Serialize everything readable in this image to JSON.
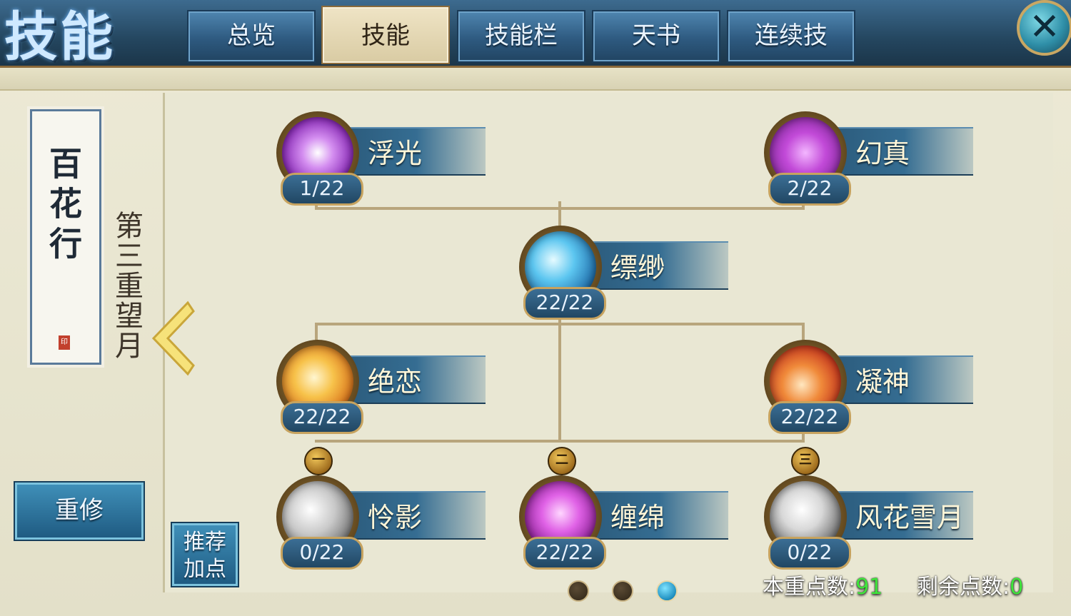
{
  "header": {
    "title": "技能",
    "tabs": [
      {
        "label": "总览",
        "active": false
      },
      {
        "label": "技能",
        "active": true
      },
      {
        "label": "技能栏",
        "active": false
      },
      {
        "label": "天书",
        "active": false
      },
      {
        "label": "连续技",
        "active": false
      }
    ],
    "close_icon": "close-icon"
  },
  "sidebar": {
    "school_name": "百花行",
    "chapter": "第三重望月",
    "rebuild_label": "重修",
    "recommend_label": "推荐\n加点"
  },
  "skills": [
    {
      "name": "浮光",
      "level": "1/22",
      "color": "#b24fd6"
    },
    {
      "name": "幻真",
      "level": "2/22",
      "color": "#c05ad8"
    },
    {
      "name": "缥缈",
      "level": "22/22",
      "color": "#3aa4e0"
    },
    {
      "name": "绝恋",
      "level": "22/22",
      "color": "#f0a62a"
    },
    {
      "name": "凝神",
      "level": "22/22",
      "color": "#e2562d"
    },
    {
      "name": "怜影",
      "level": "0/22",
      "color": "#9a9a9a"
    },
    {
      "name": "缠绵",
      "level": "22/22",
      "color": "#c748cf"
    },
    {
      "name": "风花雪月",
      "level": "0/22",
      "color": "#8a8a8a"
    }
  ],
  "tier_badges": [
    "一",
    "二",
    "三"
  ],
  "footer": {
    "points_label": "本重点数:",
    "points_value": "91",
    "remaining_label": "剩余点数:",
    "remaining_value": "0",
    "page_count": 3,
    "active_page": 3
  }
}
